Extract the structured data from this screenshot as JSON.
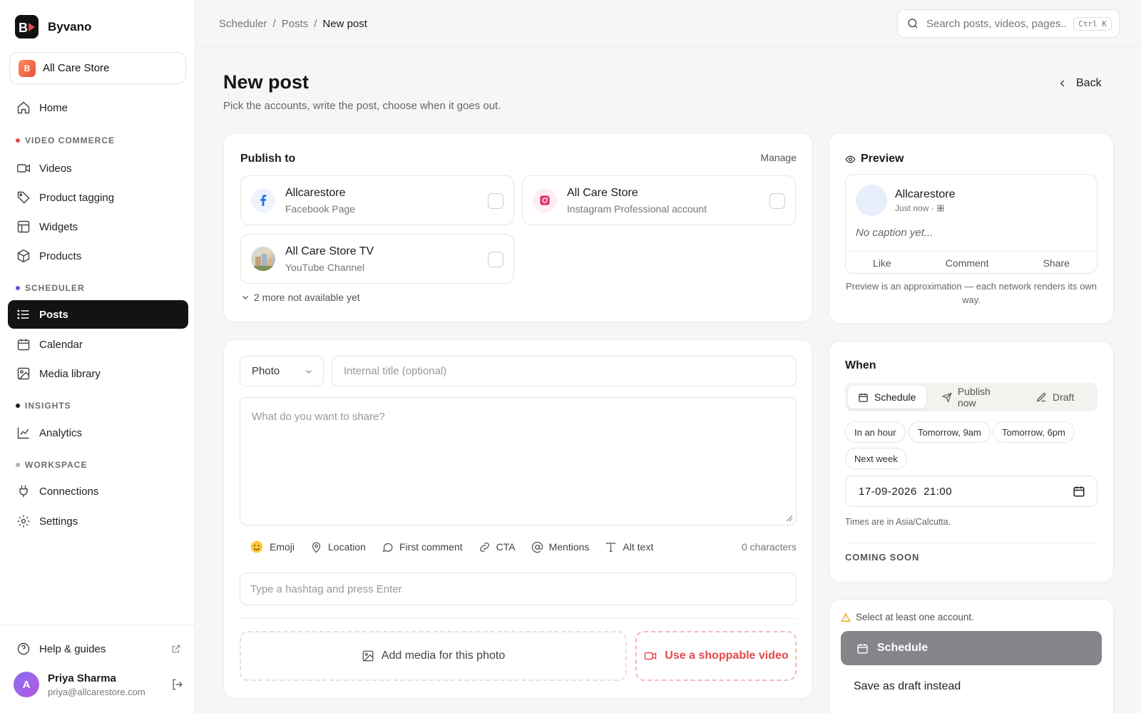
{
  "brand": {
    "name": "Byvano"
  },
  "store": {
    "name": "All Care Store",
    "badge": "B"
  },
  "nav": {
    "home": "Home",
    "sections": {
      "video_commerce": "VIDEO COMMERCE",
      "scheduler": "SCHEDULER",
      "insights": "INSIGHTS",
      "workspace": "WORKSPACE"
    },
    "videos": "Videos",
    "product_tagging": "Product tagging",
    "widgets": "Widgets",
    "products": "Products",
    "posts": "Posts",
    "calendar": "Calendar",
    "media_library": "Media library",
    "analytics": "Analytics",
    "connections": "Connections",
    "settings": "Settings",
    "help": "Help & guides"
  },
  "section_colors": {
    "video_commerce": "#e5484d",
    "scheduler": "#5b5bd6",
    "insights": "#1b1b1f",
    "workspace": "#b0b0b4"
  },
  "user": {
    "name": "Priya Sharma",
    "email": "priya@allcarestore.com",
    "initial": "A"
  },
  "breadcrumb": {
    "a": "Scheduler",
    "b": "Posts",
    "c": "New post",
    "sep": "/"
  },
  "search": {
    "placeholder": "Search posts, videos, pages...",
    "shortcut": "Ctrl K"
  },
  "page": {
    "title": "New post",
    "subtitle": "Pick the accounts, write the post, choose when it goes out.",
    "back": "Back"
  },
  "publish": {
    "title": "Publish to",
    "manage": "Manage",
    "accounts": [
      {
        "name": "Allcarestore",
        "type": "Facebook Page",
        "icon": "facebook-icon"
      },
      {
        "name": "All Care Store",
        "type": "Instagram Professional account",
        "icon": "instagram-icon"
      },
      {
        "name": "All Care Store TV",
        "type": "YouTube Channel",
        "icon": "youtube-channel-avatar"
      }
    ],
    "more": "2 more not available yet"
  },
  "composer": {
    "format": "Photo",
    "title_placeholder": "Internal title (optional)",
    "body_placeholder": "What do you want to share?",
    "tools": {
      "emoji": "Emoji",
      "location": "Location",
      "first_comment": "First comment",
      "cta": "CTA",
      "mentions": "Mentions",
      "alt_text": "Alt text"
    },
    "chars": "0 characters",
    "hashtag_placeholder": "Type a hashtag and press Enter",
    "add_media": "Add media for this photo",
    "shoppable": "Use a shoppable video"
  },
  "preview": {
    "title": "Preview",
    "name": "Allcarestore",
    "time": "Just now ·",
    "caption": "No caption yet...",
    "like": "Like",
    "comment": "Comment",
    "share": "Share",
    "note": "Preview is an approximation — each network renders its own way."
  },
  "when": {
    "title": "When",
    "schedule": "Schedule",
    "publish_now": "Publish now",
    "draft": "Draft",
    "chips": {
      "a": "In an hour",
      "b": "Tomorrow, 9am",
      "c": "Tomorrow, 6pm",
      "d": "Next week"
    },
    "datetime": "17-09-2026  21:00",
    "tz": "Times are in Asia/Calcutta.",
    "soon": "COMING SOON"
  },
  "footer": {
    "warning": "Select at least one account.",
    "schedule": "Schedule",
    "save_draft": "Save as draft instead"
  },
  "colors": {
    "accent": "#131316",
    "danger": "#e5484d",
    "warning": "#e5a000",
    "disabled": "#85858a"
  }
}
